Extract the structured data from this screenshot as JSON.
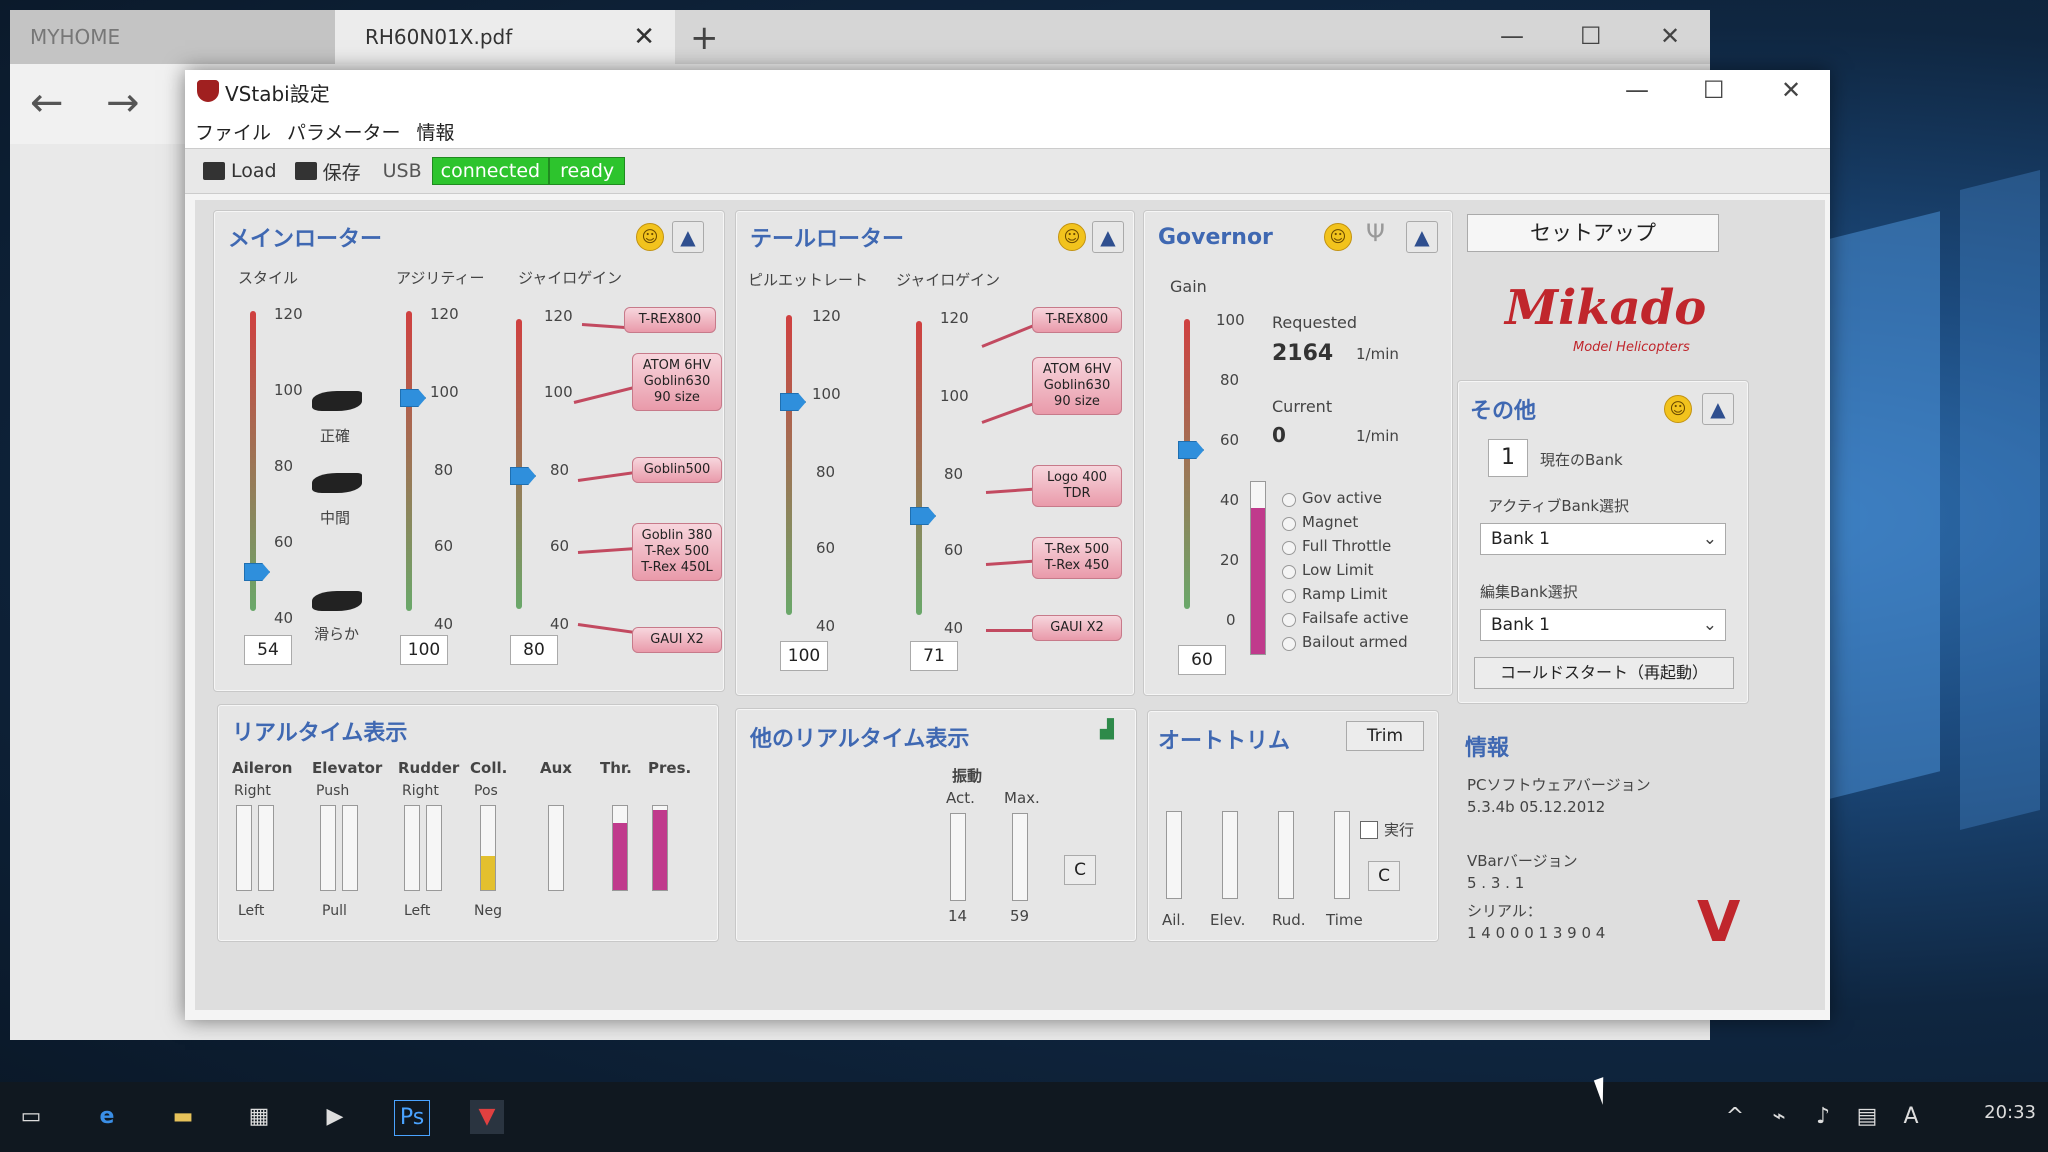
{
  "browser": {
    "tab1": "MYHOME",
    "tab2": "RH60N01X.pdf",
    "tab_close": "✕",
    "new_tab": "+",
    "back": "←",
    "forward": "→",
    "min": "—",
    "max": "☐",
    "close": "✕"
  },
  "vstabi": {
    "title": "VStabi設定",
    "menu": [
      "ファイル",
      "パラメーター",
      "情報"
    ],
    "toolbar": {
      "load": "Load",
      "save": "保存",
      "usb": "USB",
      "connected": "connected",
      "ready": "ready"
    },
    "min": "—",
    "max": "☐",
    "close": "✕"
  },
  "main_rotor": {
    "title": "メインローター",
    "col_style": "スタイル",
    "col_agility": "アジリティー",
    "col_gyro": "ジャイロゲイン",
    "scale_style": [
      "120",
      "100",
      "80",
      "60",
      "40"
    ],
    "scale_agility": [
      "120",
      "100",
      "80",
      "60",
      "40"
    ],
    "scale_gyro": [
      "120",
      "100",
      "80",
      "60",
      "40"
    ],
    "style_labels": {
      "precise": "正確",
      "mid": "中間",
      "smooth": "滑らか"
    },
    "values": {
      "style": "54",
      "agility": "100",
      "gyro": "80"
    },
    "tags": {
      "t1": "T-REX800",
      "t2a": "ATOM 6HV",
      "t2b": "Goblin630",
      "t2c": "90 size",
      "t3": "Goblin500",
      "t4a": "Goblin 380",
      "t4b": "T-Rex 500",
      "t4c": "T-Rex 450L",
      "t5": "GAUI X2"
    }
  },
  "tail_rotor": {
    "title": "テールローター",
    "col_pirouette": "ピルエットレート",
    "col_gyro": "ジャイロゲイン",
    "scale_a": [
      "120",
      "100",
      "80",
      "60",
      "40"
    ],
    "scale_b": [
      "120",
      "100",
      "80",
      "60",
      "40"
    ],
    "values": {
      "pirouette": "100",
      "gyro": "71"
    },
    "tags": {
      "t1": "T-REX800",
      "t2a": "ATOM 6HV",
      "t2b": "Goblin630",
      "t2c": "90 size",
      "t3a": "Logo 400",
      "t3b": "TDR",
      "t4a": "T-Rex 500",
      "t4b": "T-Rex 450",
      "t5": "GAUI X2"
    }
  },
  "governor": {
    "title": "Governor",
    "gain_label": "Gain",
    "scale": [
      "100",
      "80",
      "60",
      "40",
      "20",
      "0"
    ],
    "requested_label": "Requested",
    "requested_value": "2164",
    "current_label": "Current",
    "current_value": "0",
    "unit": "1/min",
    "gain_value": "60",
    "flags": [
      "Gov active",
      "Magnet",
      "Full Throttle",
      "Low Limit",
      "Ramp Limit",
      "Failsafe active",
      "Bailout armed"
    ]
  },
  "setup": {
    "button": "セットアップ",
    "brand": "Mikado",
    "brand_sub": "Model Helicopters"
  },
  "other": {
    "title": "その他",
    "bank_num": "1",
    "bank_current": "現在のBank",
    "active_bank_label": "アクティブBank選択",
    "active_bank_value": "Bank 1",
    "edit_bank_label": "編集Bank選択",
    "edit_bank_value": "Bank 1",
    "coldstart": "コールドスタート（再起動）"
  },
  "realtime": {
    "title": "リアルタイム表示",
    "headers": [
      "Aileron",
      "Elevator",
      "Rudder",
      "Coll.",
      "Aux",
      "Thr.",
      "Pres."
    ],
    "top": [
      "Right",
      "Push",
      "Right",
      "Pos"
    ],
    "bottom": [
      "Left",
      "Pull",
      "Left",
      "Neg"
    ],
    "thr_level": 0.8,
    "pres_level": 0.95,
    "coll_level": 0.4
  },
  "other_realtime": {
    "title": "他のリアルタイム表示",
    "vib_label": "振動",
    "act_label": "Act.",
    "max_label": "Max.",
    "act_value": "14",
    "max_value": "59",
    "clear": "C"
  },
  "autotrim": {
    "title": "オートトリム",
    "trim_btn": "Trim",
    "exec_label": "実行",
    "labels": [
      "Ail.",
      "Elev.",
      "Rud.",
      "Time"
    ],
    "clear": "C"
  },
  "info": {
    "title": "情報",
    "pc_version_label": "PCソフトウェアバージョン",
    "pc_version": "5.3.4b 05.12.2012",
    "vbar_label": "VBarバージョン",
    "vbar_version": "5 . 3 . 1",
    "serial_label": "シリアル：",
    "serial": "1 4 0 0 0 1 3 9 0 4"
  },
  "taskbar": {
    "clock": "20:33"
  },
  "colors": {
    "accent": "#3f68b2",
    "connected": "#2dc42d",
    "pink": "#c03a8c"
  }
}
